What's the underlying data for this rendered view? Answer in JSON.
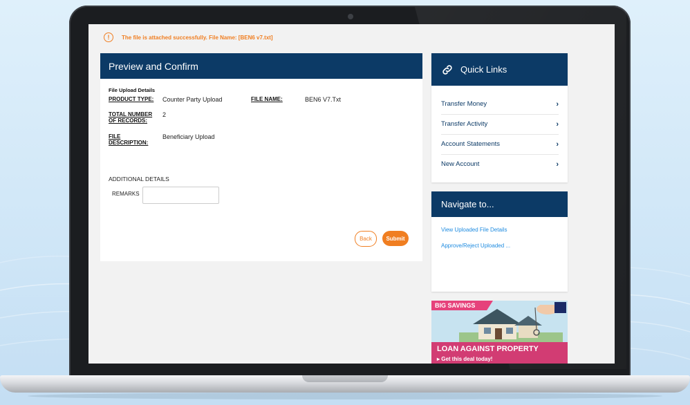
{
  "alert": {
    "icon": "exclamation-circle-icon",
    "message": "The file is attached successfully. File Name: [BEN6 v7.txt]",
    "color": "#f07e21"
  },
  "preview": {
    "title": "Preview and Confirm",
    "section_label": "File Upload Details",
    "product_type_label": "PRODUCT TYPE:",
    "product_type_value": "Counter Party Upload",
    "file_name_label": "FILE NAME:",
    "file_name_value": "BEN6 V7.Txt",
    "total_records_label_line1": "TOTAL NUMBER",
    "total_records_label_line2": "OF RECORDS:",
    "total_records_value": "2",
    "file_desc_label_line1": "FILE",
    "file_desc_label_line2": "DESCRIPTION:",
    "file_desc_value": "Beneficiary Upload",
    "additional_details": "ADDITIONAL DETAILS",
    "remarks_label": "REMARKS",
    "remarks_value": "",
    "back_label": "Back",
    "submit_label": "Submit",
    "header_color": "#0c3a66",
    "accent_color": "#f07e21"
  },
  "quick_links": {
    "title": "Quick Links",
    "icon": "link-icon",
    "items": [
      {
        "label": "Transfer Money",
        "icon": "chevron-right-icon"
      },
      {
        "label": "Transfer Activity",
        "icon": "chevron-right-icon"
      },
      {
        "label": "Account Statements",
        "icon": "chevron-right-icon"
      },
      {
        "label": "New Account",
        "icon": "chevron-right-icon"
      }
    ]
  },
  "navigate": {
    "title": "Navigate to...",
    "links": [
      "View Uploaded File Details",
      "Approve/Reject Uploaded ..."
    ]
  },
  "ad": {
    "tag": "BIG SAVINGS",
    "title": "LOAN AGAINST PROPERTY",
    "cta": "▸ Get this deal today!",
    "brand_color": "#d23c73"
  }
}
